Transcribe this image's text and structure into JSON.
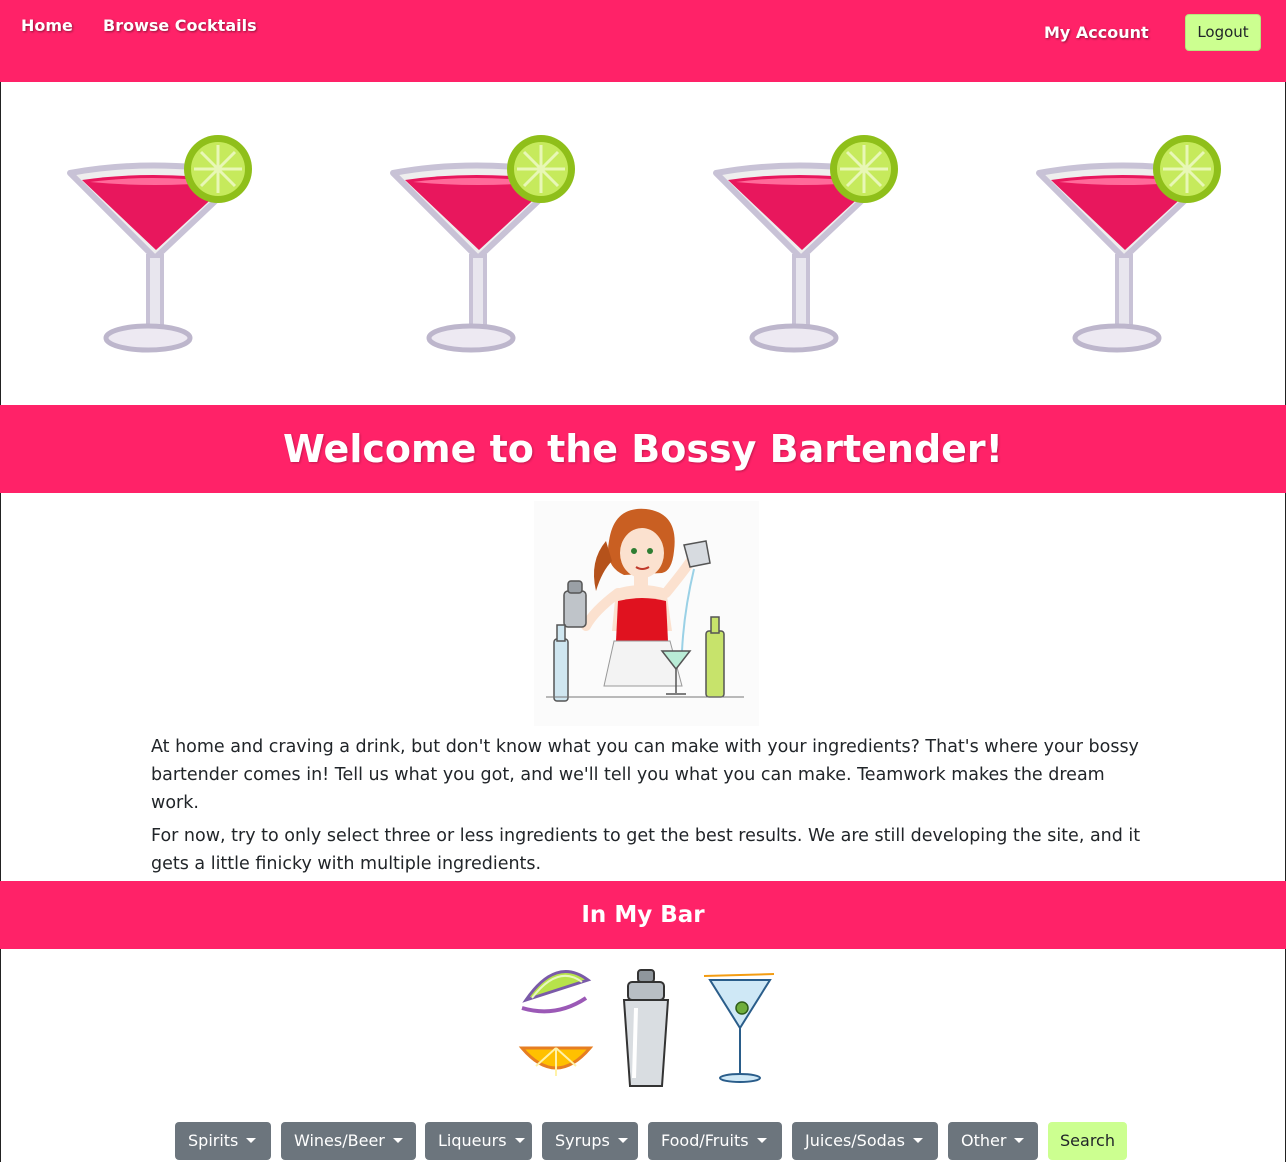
{
  "nav": {
    "home": "Home",
    "browse": "Browse Cocktails",
    "account": "My Account",
    "logout": "Logout"
  },
  "hero": {
    "glasses": [
      "cocktail-glass-icon",
      "cocktail-glass-icon",
      "cocktail-glass-icon",
      "cocktail-glass-icon"
    ]
  },
  "welcome": {
    "title": "Welcome to the Bossy Bartender!"
  },
  "intro": {
    "paragraph1": "At home and craving a drink, but don't know what you can make with your ingredients? That's where your bossy bartender comes in! Tell us what you got, and we'll tell you what you can make. Teamwork makes the dream work.",
    "paragraph2": "For now, try to only select three or less ingredients to get the best results. We are still developing the site, and it gets a little finicky with multiple ingredients."
  },
  "bar": {
    "title": "In My Bar",
    "categories": [
      "Spirits",
      "Wines/Beer",
      "Liqueurs",
      "Syrups",
      "Food/Fruits",
      "Juices/Sodas",
      "Other"
    ],
    "search_label": "Search"
  },
  "colors": {
    "brand_pink": "#ff2268",
    "accent_lime": "#ccff90",
    "dropdown_gray": "#6c757d"
  }
}
